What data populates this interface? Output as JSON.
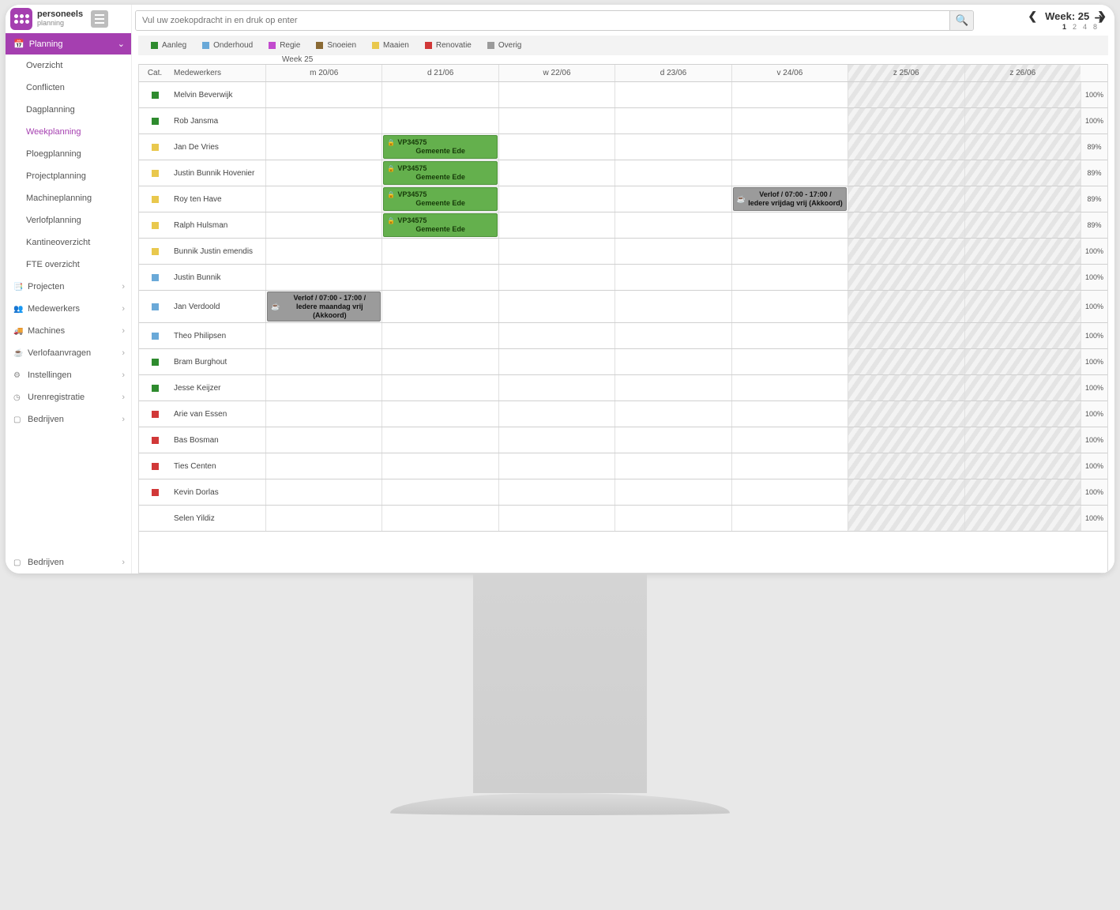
{
  "logo": {
    "main": "personeels",
    "sub": "planning"
  },
  "nav": {
    "planning_header": "Planning",
    "items": [
      "Overzicht",
      "Conflicten",
      "Dagplanning",
      "Weekplanning",
      "Ploegplanning",
      "Projectplanning",
      "Machineplanning",
      "Verlofplanning",
      "Kantineoverzicht",
      "FTE overzicht"
    ],
    "sections": [
      "Projecten",
      "Medewerkers",
      "Machines",
      "Verlofaanvragen",
      "Instellingen",
      "Urenregistratie",
      "Bedrijven"
    ],
    "sections2": [
      "Bedrijven"
    ]
  },
  "search": {
    "placeholder": "Vul uw zoekopdracht in en druk op enter"
  },
  "week": {
    "label": "Week: 25",
    "title": "Week 25",
    "sizes": [
      "1",
      "2",
      "4",
      "8"
    ]
  },
  "legend": [
    {
      "label": "Aanleg",
      "color": "#2e8b2e"
    },
    {
      "label": "Onderhoud",
      "color": "#6aa9d8"
    },
    {
      "label": "Regie",
      "color": "#c24bce"
    },
    {
      "label": "Snoeien",
      "color": "#8a6a34"
    },
    {
      "label": "Maaien",
      "color": "#e9c84d"
    },
    {
      "label": "Renovatie",
      "color": "#d13838"
    },
    {
      "label": "Overig",
      "color": "#9b9b9b"
    }
  ],
  "headers": {
    "cat": "Cat.",
    "name": "Medewerkers",
    "days": [
      "m 20/06",
      "d 21/06",
      "w 22/06",
      "d 23/06",
      "v 24/06",
      "z 25/06",
      "z 26/06"
    ]
  },
  "rows": [
    {
      "cat": "#2e8b2e",
      "name": "Melvin Beverwijk",
      "pct": "100%",
      "events": {}
    },
    {
      "cat": "#2e8b2e",
      "name": "Rob Jansma",
      "pct": "100%",
      "events": {}
    },
    {
      "cat": "#e9c84d",
      "name": "Jan De Vries",
      "pct": "89%",
      "events": {
        "1": {
          "type": "green",
          "t1": "VP34575",
          "t2": "Gemeente Ede"
        }
      }
    },
    {
      "cat": "#e9c84d",
      "name": "Justin Bunnik Hovenier",
      "pct": "89%",
      "events": {
        "1": {
          "type": "green",
          "t1": "VP34575",
          "t2": "Gemeente Ede"
        }
      }
    },
    {
      "cat": "#e9c84d",
      "name": "Roy ten Have",
      "pct": "89%",
      "events": {
        "1": {
          "type": "green",
          "t1": "VP34575",
          "t2": "Gemeente Ede"
        },
        "4": {
          "type": "gray",
          "t1": "Verlof / 07:00 - 17:00 / Iedere vrijdag vrij (Akkoord)"
        }
      }
    },
    {
      "cat": "#e9c84d",
      "name": "Ralph Hulsman",
      "pct": "89%",
      "events": {
        "1": {
          "type": "green",
          "t1": "VP34575",
          "t2": "Gemeente Ede"
        }
      }
    },
    {
      "cat": "#e9c84d",
      "name": "Bunnik Justin emendis",
      "pct": "100%",
      "events": {}
    },
    {
      "cat": "#6aa9d8",
      "name": "Justin Bunnik",
      "pct": "100%",
      "events": {}
    },
    {
      "cat": "#6aa9d8",
      "name": "Jan Verdoold",
      "pct": "100%",
      "events": {
        "0": {
          "type": "gray",
          "t1": "Verlof / 07:00 - 17:00 / Iedere maandag vrij (Akkoord)"
        }
      }
    },
    {
      "cat": "#6aa9d8",
      "name": "Theo Philipsen",
      "pct": "100%",
      "events": {}
    },
    {
      "cat": "#2e8b2e",
      "name": "Bram Burghout",
      "pct": "100%",
      "events": {}
    },
    {
      "cat": "#2e8b2e",
      "name": "Jesse Keijzer",
      "pct": "100%",
      "events": {}
    },
    {
      "cat": "#d13838",
      "name": "Arie van Essen",
      "pct": "100%",
      "events": {}
    },
    {
      "cat": "#d13838",
      "name": "Bas Bosman",
      "pct": "100%",
      "events": {}
    },
    {
      "cat": "#d13838",
      "name": "Ties Centen",
      "pct": "100%",
      "events": {}
    },
    {
      "cat": "#d13838",
      "name": "Kevin Dorlas",
      "pct": "100%",
      "events": {}
    },
    {
      "cat": "",
      "name": "Selen Yildiz",
      "pct": "100%",
      "events": {}
    }
  ]
}
